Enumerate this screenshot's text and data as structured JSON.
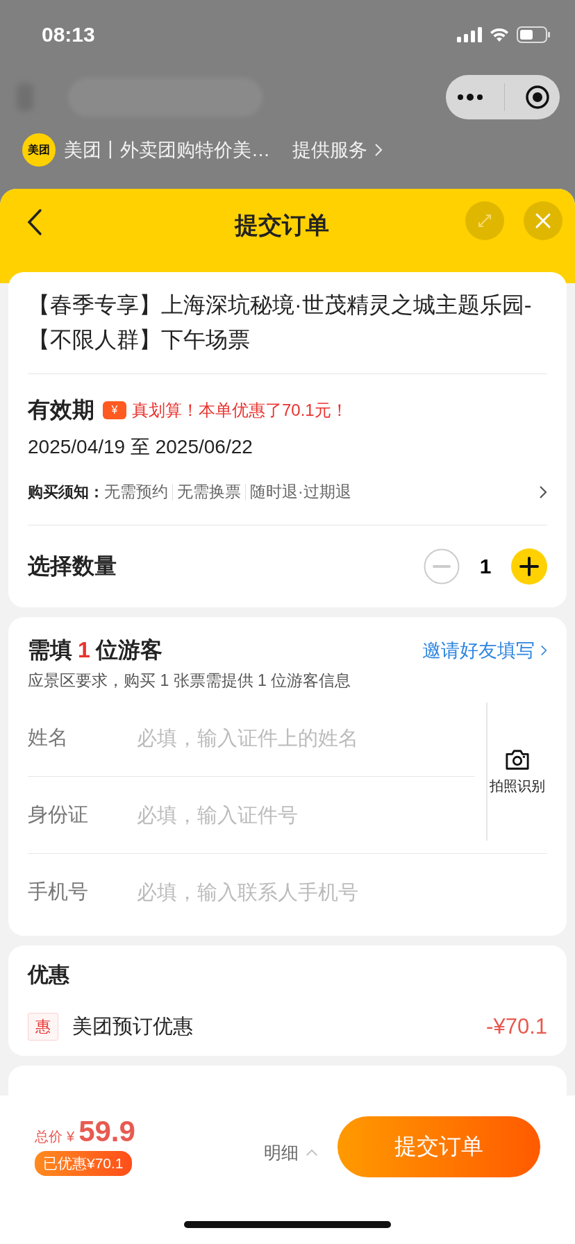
{
  "status_bar": {
    "time": "08:13"
  },
  "background_page": {
    "brand_badge": "美团",
    "brand_name": "美团丨外卖团购特价美…",
    "service_link": "提供服务"
  },
  "sheet": {
    "title": "提交订单"
  },
  "product": {
    "title": "【春季专享】上海深坑秘境·世茂精灵之城主题乐园-【不限人群】下午场票",
    "validity_label": "有效期",
    "promo_badge": "¥",
    "promo": "真划算！本单优惠了70.1元！",
    "dates": "2025/04/19 至 2025/06/22",
    "notice_label": "购买须知：",
    "notice_items": [
      "无需预约",
      "无需换票",
      "随时退·过期退"
    ]
  },
  "quantity": {
    "label": "选择数量",
    "value": "1",
    "decrement_disabled": true
  },
  "travelers": {
    "title_prefix": "需填",
    "count": "1",
    "title_suffix": "位游客",
    "invite_link": "邀请好友填写",
    "note": "应景区要求，购买 1 张票需提供 1 位游客信息",
    "photo_label": "拍照识别",
    "fields": [
      {
        "label": "姓名",
        "placeholder": "必填，输入证件上的姓名"
      },
      {
        "label": "身份证",
        "placeholder": "必填，输入证件号"
      },
      {
        "label": "手机号",
        "placeholder": "必填，输入联系人手机号"
      }
    ]
  },
  "discounts": {
    "title": "优惠",
    "items": [
      {
        "tag": "惠",
        "name": "美团预订优惠",
        "amount": "-¥70.1"
      }
    ]
  },
  "footer": {
    "total_label": "总价",
    "currency": "¥",
    "total": "59.9",
    "saved": "已优惠¥70.1",
    "details": "明细",
    "submit": "提交订单"
  }
}
